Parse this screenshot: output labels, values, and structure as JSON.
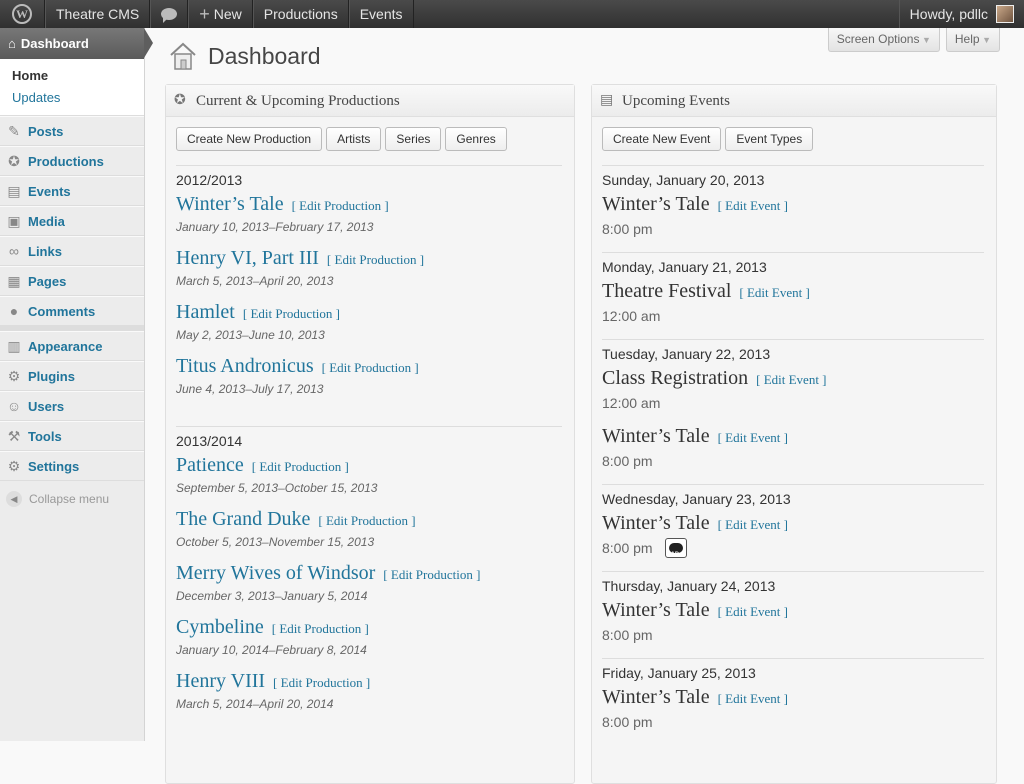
{
  "adminbar": {
    "site_name": "Theatre CMS",
    "new_label": "New",
    "items": [
      "Productions",
      "Events"
    ],
    "howdy": "Howdy, pdllc"
  },
  "sidebar": {
    "dashboard": "Dashboard",
    "sub": [
      "Home",
      "Updates"
    ],
    "menu1": [
      {
        "label": "Posts",
        "icon": "pin-icon"
      },
      {
        "label": "Productions",
        "icon": "star-icon"
      },
      {
        "label": "Events",
        "icon": "calendar-icon"
      },
      {
        "label": "Media",
        "icon": "media-icon"
      },
      {
        "label": "Links",
        "icon": "links-icon"
      },
      {
        "label": "Pages",
        "icon": "pages-icon"
      },
      {
        "label": "Comments",
        "icon": "comments-icon"
      }
    ],
    "menu2": [
      {
        "label": "Appearance",
        "icon": "appearance-icon"
      },
      {
        "label": "Plugins",
        "icon": "plugins-icon"
      },
      {
        "label": "Users",
        "icon": "users-icon"
      },
      {
        "label": "Tools",
        "icon": "tools-icon"
      },
      {
        "label": "Settings",
        "icon": "settings-icon"
      }
    ],
    "collapse": "Collapse menu"
  },
  "screen_meta": {
    "screen_options": "Screen Options",
    "help": "Help"
  },
  "page_title": "Dashboard",
  "productions": {
    "title": "Current & Upcoming Productions",
    "buttons": [
      "Create New Production",
      "Artists",
      "Series",
      "Genres"
    ],
    "edit_label": "[ Edit Production ]",
    "seasons": [
      {
        "name": "2012/2013",
        "items": [
          {
            "title": "Winter’s Tale",
            "dates": "January 10, 2013–February 17, 2013"
          },
          {
            "title": "Henry VI, Part III",
            "dates": "March 5, 2013–April 20, 2013"
          },
          {
            "title": "Hamlet",
            "dates": "May 2, 2013–June 10, 2013"
          },
          {
            "title": "Titus Andronicus",
            "dates": "June 4, 2013–July 17, 2013"
          }
        ]
      },
      {
        "name": "2013/2014",
        "items": [
          {
            "title": "Patience",
            "dates": "September 5, 2013–October 15, 2013"
          },
          {
            "title": "The Grand Duke",
            "dates": "October 5, 2013–November 15, 2013"
          },
          {
            "title": "Merry Wives of Windsor",
            "dates": "December 3, 2013–January 5, 2014"
          },
          {
            "title": "Cymbeline",
            "dates": "January 10, 2014–February 8, 2014"
          },
          {
            "title": "Henry VIII",
            "dates": "March 5, 2014–April 20, 2014"
          }
        ]
      }
    ]
  },
  "events": {
    "title": "Upcoming Events",
    "buttons": [
      "Create New Event",
      "Event Types"
    ],
    "edit_label": "[ Edit Event ]",
    "days": [
      {
        "date": "Sunday, January 20, 2013",
        "items": [
          {
            "title": "Winter’s Tale",
            "time": "8:00 pm"
          }
        ]
      },
      {
        "date": "Monday, January 21, 2013",
        "items": [
          {
            "title": "Theatre Festival",
            "time": "12:00 am"
          }
        ]
      },
      {
        "date": "Tuesday, January 22, 2013",
        "items": [
          {
            "title": "Class Registration",
            "time": "12:00 am"
          },
          {
            "title": "Winter’s Tale",
            "time": "8:00 pm"
          }
        ]
      },
      {
        "date": "Wednesday, January 23, 2013",
        "items": [
          {
            "title": "Winter’s Tale",
            "time": "8:00 pm",
            "badge": "AD"
          }
        ]
      },
      {
        "date": "Thursday, January 24, 2013",
        "items": [
          {
            "title": "Winter’s Tale",
            "time": "8:00 pm"
          }
        ]
      },
      {
        "date": "Friday, January 25, 2013",
        "items": [
          {
            "title": "Winter’s Tale",
            "time": "8:00 pm"
          }
        ]
      }
    ]
  }
}
